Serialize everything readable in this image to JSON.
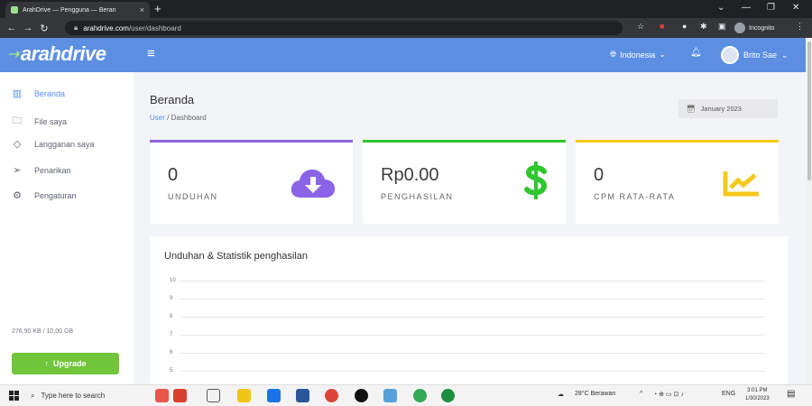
{
  "browser": {
    "tab_title": "ArahDrive — Pengguna — Beran",
    "new_tab": "+",
    "url_host": "arahdrive.com",
    "url_path": "/user/dashboard",
    "incognito_label": "Incognito",
    "win_min": "⌄",
    "win_restore": "—",
    "win_max": "❐",
    "win_close": "✕"
  },
  "header": {
    "logo": "arahdrive",
    "menu_icon": "≡",
    "language": "Indonesia",
    "user_name": "Brito Sae"
  },
  "sidebar": {
    "items": [
      {
        "label": "Beranda",
        "icon": "dashboard-icon",
        "active": true
      },
      {
        "label": "File saya",
        "icon": "folder-icon",
        "active": false
      },
      {
        "label": "Langganan saya",
        "icon": "diamond-icon",
        "active": false
      },
      {
        "label": "Penarikan",
        "icon": "send-icon",
        "active": false
      },
      {
        "label": "Pengaturan",
        "icon": "gear-icon",
        "active": false
      }
    ],
    "storage": "276,90 KB / 10,00 GB",
    "upgrade_label": "Upgrade"
  },
  "main": {
    "title": "Beranda",
    "breadcrumb": {
      "link": "User",
      "separator": "/",
      "current": "Dashboard"
    },
    "date_picker": "January 2023",
    "cards": [
      {
        "value": "0",
        "label": "UNDUHAN",
        "icon": "cloud-download-icon",
        "accent": "#8b63e6"
      },
      {
        "value": "Rp0.00",
        "label": "PENGHASILAN",
        "icon": "dollar-icon",
        "accent": "#2ec72e"
      },
      {
        "value": "0",
        "label": "CPM RATA-RATA",
        "icon": "chart-line-icon",
        "accent": "#f4c81c"
      }
    ],
    "chart_title": "Unduhan & Statistik penghasilan",
    "y_ticks": [
      "10",
      "9",
      "8",
      "7",
      "6",
      "5"
    ]
  },
  "taskbar": {
    "search_placeholder": "Type here to search",
    "weather": "28°C  Berawan",
    "lang": "ENG",
    "time": "3:01 PM",
    "date": "1/30/2023"
  },
  "colors": {
    "header": "#5c8fe2",
    "upgrade": "#71c53a",
    "active_link": "#5b8def"
  }
}
